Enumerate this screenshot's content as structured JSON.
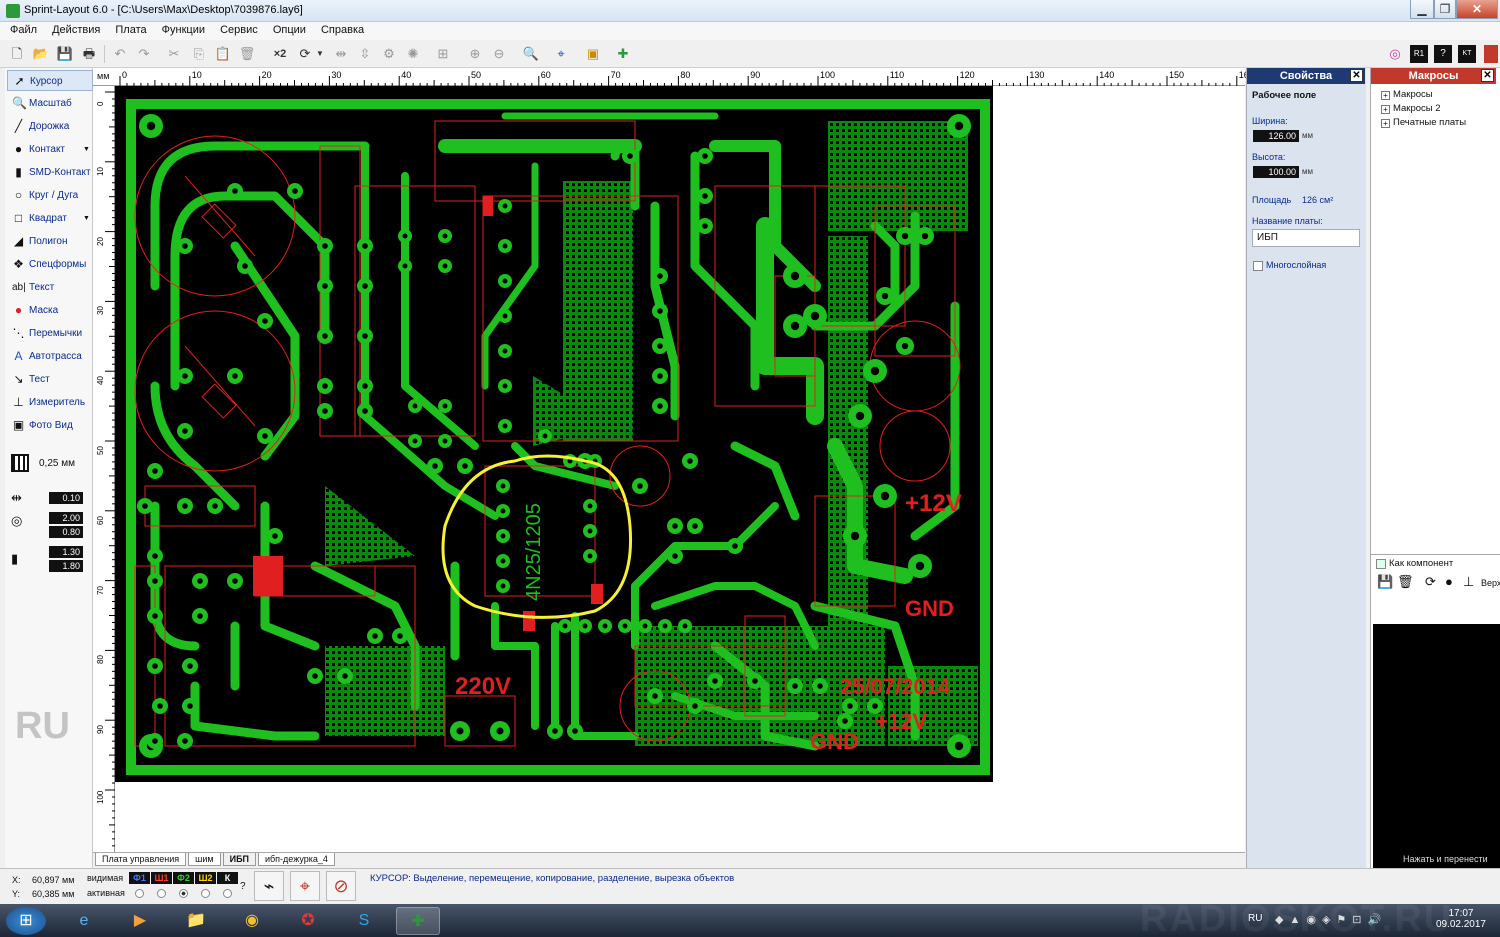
{
  "window": {
    "title": "Sprint-Layout 6.0 - [C:\\Users\\Max\\Desktop\\7039876.lay6]",
    "btn_min": "▁",
    "btn_max": "❐",
    "btn_close": "✕"
  },
  "menu": [
    "Файл",
    "Действия",
    "Плата",
    "Функции",
    "Сервис",
    "Опции",
    "Справка"
  ],
  "toolbar": {
    "x2_label": "×2"
  },
  "tools": [
    {
      "label": "Курсор",
      "icon": "cursor-icon"
    },
    {
      "label": "Масштаб",
      "icon": "zoom-icon"
    },
    {
      "label": "Дорожка",
      "icon": "track-icon"
    },
    {
      "label": "Контакт",
      "icon": "pad-icon"
    },
    {
      "label": "SMD-Контакт",
      "icon": "smd-pad-icon"
    },
    {
      "label": "Круг / Дуга",
      "icon": "circle-icon"
    },
    {
      "label": "Квадрат",
      "icon": "square-icon"
    },
    {
      "label": "Полигон",
      "icon": "polygon-icon"
    },
    {
      "label": "Спецформы",
      "icon": "special-forms-icon"
    },
    {
      "label": "Текст",
      "icon": "text-icon"
    },
    {
      "label": "Маска",
      "icon": "mask-icon"
    },
    {
      "label": "Перемычки",
      "icon": "jumper-icon"
    },
    {
      "label": "Автотрасса",
      "icon": "autoroute-icon"
    },
    {
      "label": "Тест",
      "icon": "test-icon"
    },
    {
      "label": "Измеритель",
      "icon": "measure-icon"
    },
    {
      "label": "Фото Вид",
      "icon": "photo-view-icon"
    }
  ],
  "grid": {
    "value": "0,25 мм"
  },
  "track_params": {
    "track_width": "0.10",
    "pad_outer": "2.00",
    "pad_inner": "0.80",
    "smd_w": "1.30",
    "smd_h": "1.80"
  },
  "watermark_ru": "RU",
  "ruler": {
    "unit": "мм",
    "top_labels": [
      "0",
      "10",
      "20",
      "30",
      "40",
      "50",
      "60",
      "70",
      "80",
      "90",
      "100",
      "110",
      "120",
      "130",
      "140",
      "150",
      "16"
    ],
    "left_labels": [
      "0",
      "10",
      "20",
      "30",
      "40",
      "50",
      "60",
      "70",
      "80",
      "90",
      "100"
    ]
  },
  "board": {
    "silk_texts": [
      "220V",
      "+12V",
      "GND",
      "25/07/2014",
      "+12V",
      "GND"
    ],
    "chip_marking": "4N25/1205"
  },
  "tabs": [
    "Плата управления",
    "шим",
    "ИБП",
    "ибп-дежурка_4"
  ],
  "status": {
    "x_label": "X:",
    "x_value": "60,897 мм",
    "y_label": "Y:",
    "y_value": "60,385 мм",
    "visible_label": "видимая",
    "active_label": "активная",
    "layers": [
      {
        "name": "Ф1",
        "color": "#3d7cff"
      },
      {
        "name": "Ш1",
        "color": "#ff3b30"
      },
      {
        "name": "Ф2",
        "color": "#33cc33"
      },
      {
        "name": "Ш2",
        "color": "#ffd400"
      },
      {
        "name": "К",
        "color": "#ffffff"
      }
    ],
    "question": "?",
    "message": "КУРСОР: Выделение, перемещение, копирование, разделение, вырезка объектов"
  },
  "properties": {
    "header": "Свойства",
    "section": "Рабочее поле",
    "width_label": "Ширина:",
    "width_value": "126.00",
    "height_label": "Высота:",
    "height_value": "100.00",
    "unit": "мм",
    "area_label": "Площадь",
    "area_value": "126 см²",
    "name_label": "Название платы:",
    "name_value": "ИБП",
    "multilayer_label": "Многослойная"
  },
  "macros": {
    "header": "Макросы",
    "items": [
      "Макросы",
      "Макросы 2",
      "Печатные платы"
    ],
    "as_component_label": "Как компонент",
    "top_label": "Верх",
    "footer": "Нажать и перенести"
  },
  "taskbar": {
    "lang": "RU",
    "time": "17:07",
    "date": "09.02.2017",
    "watermark": "RADIOSKOT.RU"
  }
}
